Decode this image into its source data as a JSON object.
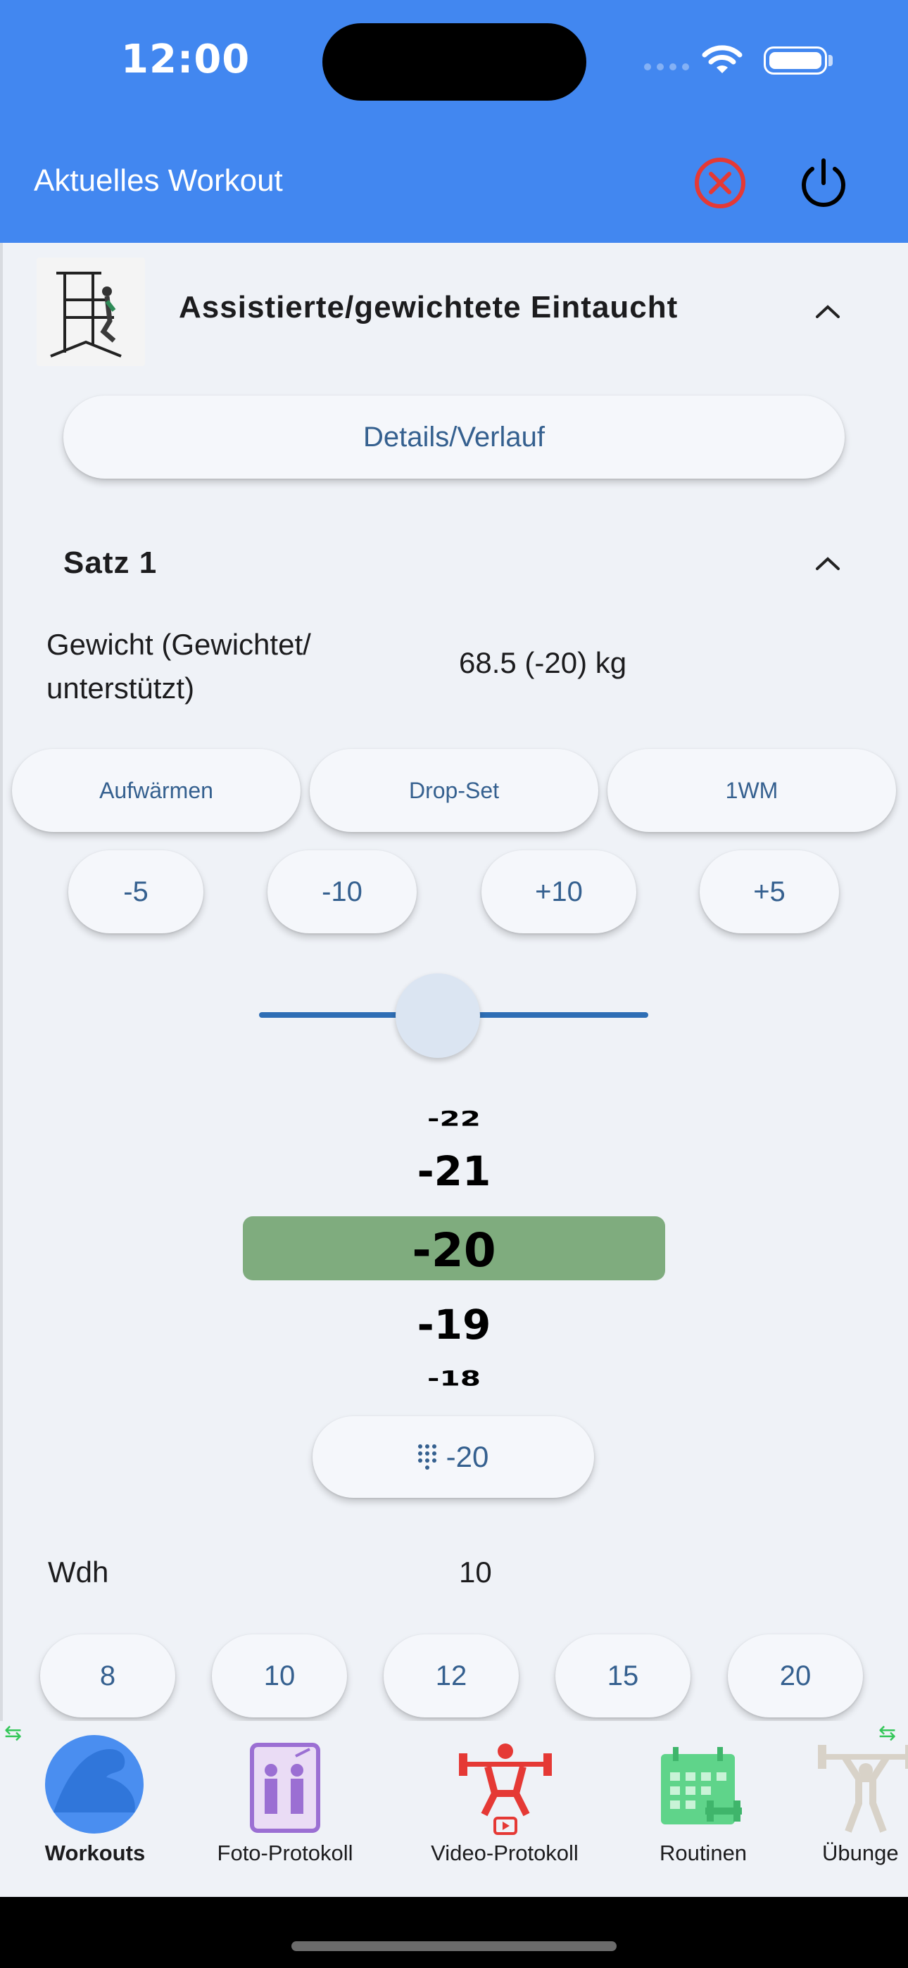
{
  "status_bar": {
    "time": "12:00"
  },
  "header": {
    "title": "Aktuelles Workout"
  },
  "exercise": {
    "title": "Assistierte/gewichtete Eintaucht",
    "details_button": "Details/Verlauf"
  },
  "set": {
    "title": "Satz 1",
    "weight_label": "Gewicht (Gewichtet/ unterstützt)",
    "weight_value": "68.5 (-20) kg",
    "options": [
      "Aufwärmen",
      "Drop-Set",
      "1WM"
    ],
    "steps": [
      "-5",
      "-10",
      "+10",
      "+5"
    ],
    "slider_value": 0.46,
    "picker": [
      "-22",
      "-21",
      "-20",
      "-19",
      "-18"
    ],
    "picker_selected": "-20",
    "keypad_value": "-20",
    "reps_label": "Wdh",
    "reps_value": "10",
    "rep_options": [
      "8",
      "10",
      "12",
      "15",
      "20"
    ]
  },
  "nav": {
    "items": [
      {
        "label": "Workouts",
        "icon": "biceps-icon",
        "active": true
      },
      {
        "label": "Foto-Protokoll",
        "icon": "mirror-photo-icon"
      },
      {
        "label": "Video-Protokoll",
        "icon": "weightlifter-video-icon"
      },
      {
        "label": "Routinen",
        "icon": "calendar-dumbbell-icon"
      },
      {
        "label": "Übunge",
        "icon": "barbell-person-icon"
      }
    ]
  },
  "colors": {
    "header": "#4287f0",
    "accent_text": "#35608f",
    "picker_highlight": "#7fac7e",
    "close_red": "#e53935"
  }
}
